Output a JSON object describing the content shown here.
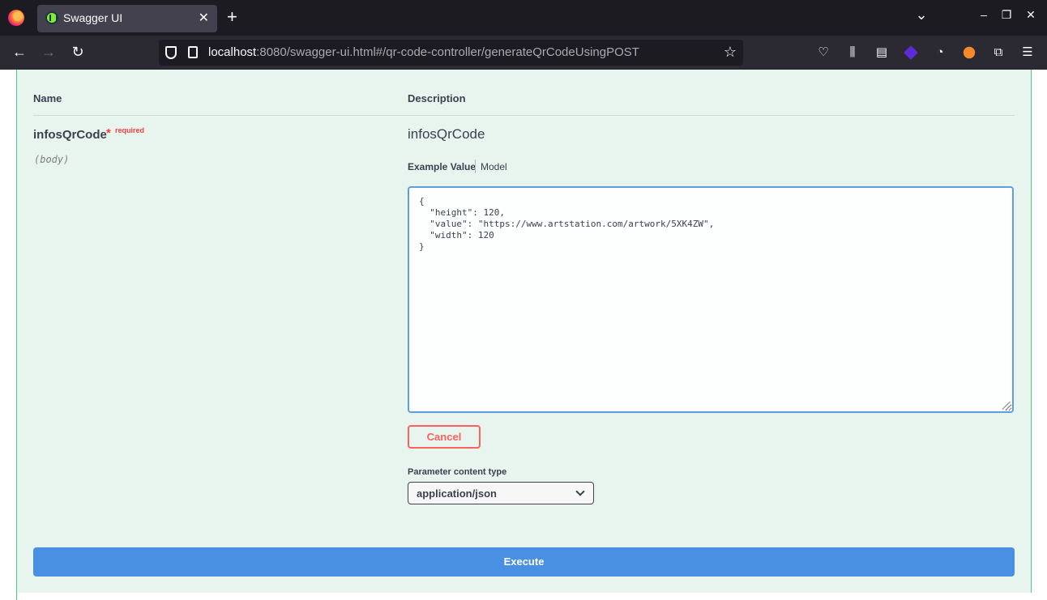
{
  "browser": {
    "tab_title": "Swagger UI",
    "url_host": "localhost",
    "url_rest": ":8080/swagger-ui.html#/qr-code-controller/generateQrCodeUsingPOST",
    "window_controls": {
      "dropdown": "⌄",
      "minimize": "–",
      "maximize": "❐",
      "close": "✕"
    },
    "tab_close": "✕",
    "new_tab": "+"
  },
  "params": {
    "col_name": "Name",
    "col_description": "Description",
    "param_name": "infosQrCode",
    "required_star": "*",
    "required_label": "required",
    "param_in": "(body)",
    "param_desc": "infosQrCode",
    "example_tab": "Example Value",
    "model_tab": "Model",
    "body_value": "{\n  \"height\": 120,\n  \"value\": \"https://www.artstation.com/artwork/5XK4ZW\",\n  \"width\": 120\n}",
    "cancel_label": "Cancel",
    "content_type_label": "Parameter content type",
    "content_type_value": "application/json",
    "execute_label": "Execute"
  },
  "colors": {
    "opblock_bg": "#e8f4ee",
    "opblock_border": "#49cc90",
    "execute_bg": "#4990e2",
    "cancel": "#ff6060"
  }
}
